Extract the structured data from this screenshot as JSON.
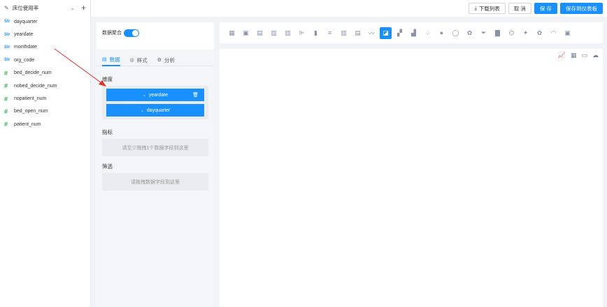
{
  "sidebar": {
    "dataset_name": "床位使用率",
    "fields": [
      {
        "name": "dayquarter",
        "type": "Str",
        "icon": "string-type-icon"
      },
      {
        "name": "yeardate",
        "type": "Str",
        "icon": "string-type-icon"
      },
      {
        "name": "monthdate",
        "type": "Str",
        "icon": "string-type-icon"
      },
      {
        "name": "org_code",
        "type": "Str",
        "icon": "string-type-icon"
      },
      {
        "name": "bed_decide_num",
        "type": "#",
        "icon": "number-type-icon"
      },
      {
        "name": "nobed_decide_num",
        "type": "#",
        "icon": "number-type-icon"
      },
      {
        "name": "nopatient_num",
        "type": "#",
        "icon": "number-type-icon"
      },
      {
        "name": "bed_open_num",
        "type": "#",
        "icon": "number-type-icon"
      },
      {
        "name": "patient_num",
        "type": "#",
        "icon": "number-type-icon"
      }
    ]
  },
  "toolbar": {
    "download_label": "下载列表",
    "cancel_label": "取 消",
    "save_label": "保 存",
    "save_dashboard_label": "保存到仪表板"
  },
  "panel": {
    "aggregate_label": "数据聚合",
    "aggregate_on": true,
    "tabs": [
      {
        "label": "数据",
        "active": true
      },
      {
        "label": "样式",
        "active": false
      },
      {
        "label": "分析",
        "active": false
      }
    ],
    "dimension_title": "维度",
    "dimensions": [
      "yeardate",
      "dayquarter"
    ],
    "metric_title": "指标",
    "metric_placeholder": "请至少拖拽1个数据字段到这里",
    "filter_title": "筛选",
    "filter_placeholder": "请拖拽数据字段到这里"
  },
  "chart_types": {
    "icons": [
      "table-icon",
      "pivot-table-icon",
      "detail-table-icon",
      "cross-table-icon",
      "column-chart-icon",
      "bar-chart-icon",
      "grouped-column-icon",
      "stacked-bar-icon",
      "stacked-column-icon",
      "horizontal-bar-icon",
      "area-chart-icon",
      "line-chart-icon",
      "combo-chart-icon",
      "waterfall-icon",
      "scatter-icon",
      "pie-chart-icon",
      "ring-chart-icon",
      "rose-chart-icon",
      "funnel-icon",
      "histogram-icon",
      "tree-icon",
      "map-icon",
      "heat-map-icon",
      "gauge-icon",
      "indicator-card-icon"
    ],
    "selected_index": 11
  },
  "canvas_views": [
    "chart-view-icon",
    "table-view-icon",
    "monitor-icon",
    "cloud-download-icon"
  ],
  "colors": {
    "accent": "#1890ff",
    "number_icon": "#2aa845",
    "arrow": "#e0312c"
  }
}
